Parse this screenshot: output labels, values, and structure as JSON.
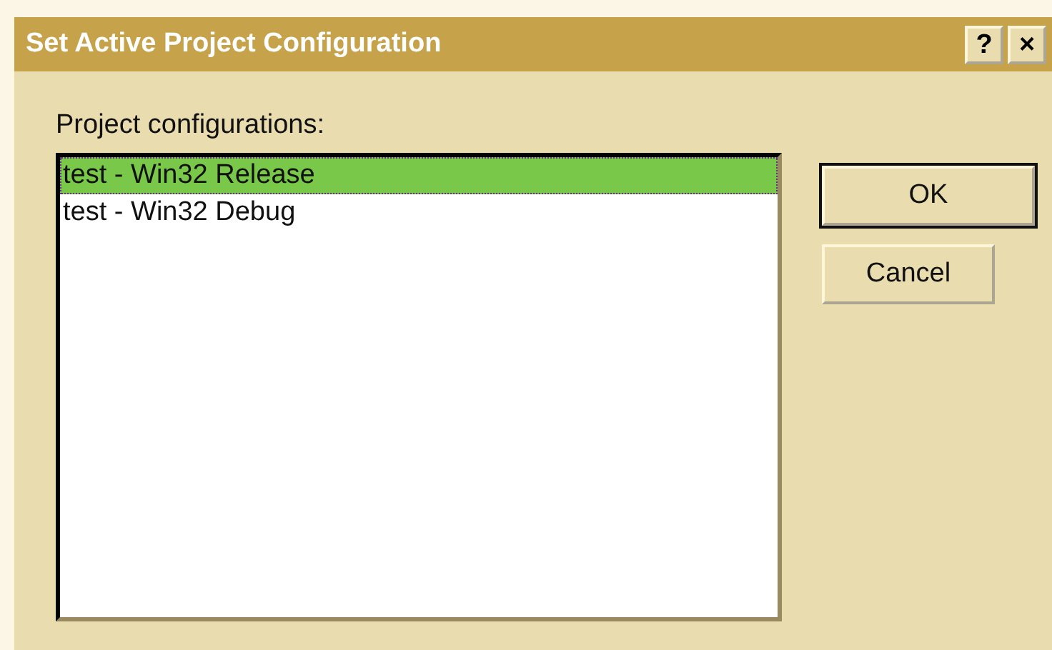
{
  "window": {
    "title": "Set Active Project Configuration",
    "title_buttons": [
      "?",
      "×"
    ]
  },
  "list": {
    "label": "Project configurations:",
    "items": [
      {
        "text": "test - Win32 Release",
        "selected": true
      },
      {
        "text": "test - Win32 Debug",
        "selected": false
      }
    ]
  },
  "buttons": [
    {
      "label": "OK",
      "default": true
    },
    {
      "label": "Cancel",
      "default": false
    }
  ]
}
